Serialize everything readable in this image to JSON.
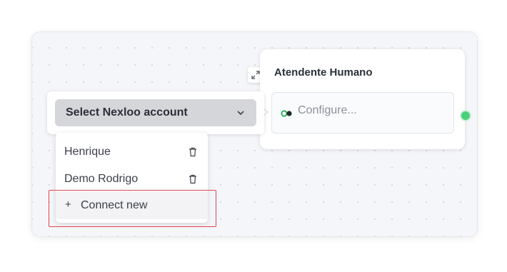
{
  "node": {
    "title": "Atendente Humano",
    "configure_placeholder": "Configure..."
  },
  "select": {
    "label": "Select Nexloo account"
  },
  "dropdown": {
    "items": [
      {
        "label": "Henrique"
      },
      {
        "label": "Demo Rodrigo"
      }
    ],
    "connect_label": "Connect new",
    "connect_symbol": "+"
  },
  "colors": {
    "handle": "#4ccf7c",
    "highlight": "#e0454b"
  },
  "icons": {
    "expand": "expand-icon",
    "chevron": "chevron-down-icon",
    "trash": "trash-icon",
    "configure": "link-icon"
  }
}
